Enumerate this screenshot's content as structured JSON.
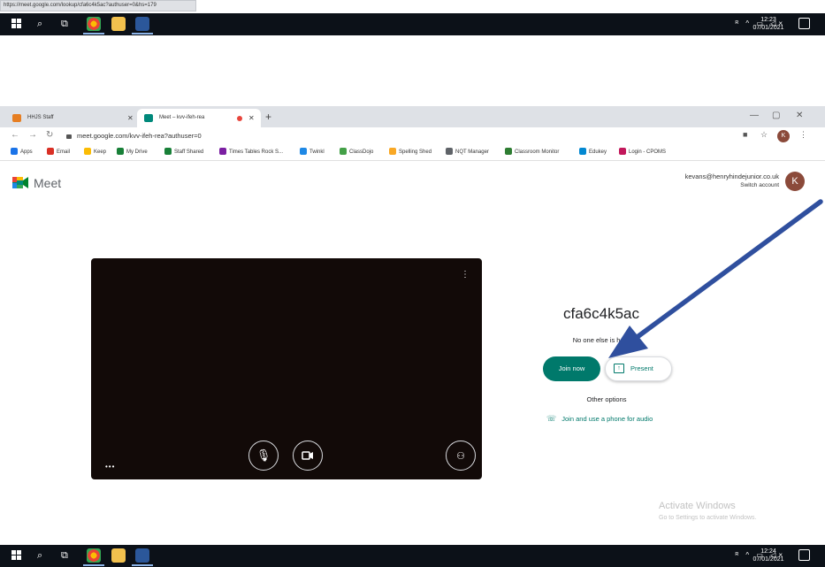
{
  "status_url": "https://meet.google.com/lookup/cfa6c4k5ac?authuser=0&hs=179",
  "taskbar_top": {
    "time": "12:23",
    "date": "07/01/2021"
  },
  "taskbar_bottom": {
    "time": "12:24",
    "date": "07/01/2021"
  },
  "browser": {
    "tabs": [
      {
        "label": "HHJS Staff"
      },
      {
        "label": "Meet – kvv-ifeh-rea"
      }
    ],
    "address": "meet.google.com/kvv-ifeh-rea?authuser=0",
    "profile_initial": "K",
    "bookmarks": [
      {
        "label": "Apps",
        "color": "#1a73e8"
      },
      {
        "label": "Email",
        "color": "#d93025"
      },
      {
        "label": "Keep",
        "color": "#fbbc04"
      },
      {
        "label": "My Drive",
        "color": "#188038"
      },
      {
        "label": "Staff Shared",
        "color": "#188038"
      },
      {
        "label": "Times Tables Rock S...",
        "color": "#7b1fa2"
      },
      {
        "label": "Twinkl",
        "color": "#1e88e5"
      },
      {
        "label": "ClassDojo",
        "color": "#43a047"
      },
      {
        "label": "Spelling Shed",
        "color": "#f9a825"
      },
      {
        "label": "NQT Manager",
        "color": "#5f6368"
      },
      {
        "label": "Classroom Monitor",
        "color": "#2e7d32"
      },
      {
        "label": "Edukey",
        "color": "#0288d1"
      },
      {
        "label": "Login - CPOMS",
        "color": "#c2185b"
      }
    ]
  },
  "meet": {
    "logo_text": "Meet",
    "account_email": "kevans@henryhindejunior.co.uk",
    "switch_account": "Switch account",
    "avatar_initial": "K",
    "meeting_code": "cfa6c4k5ac",
    "status": "No one else is here",
    "join_label": "Join now",
    "present_label": "Present",
    "other_options": "Other options",
    "phone_audio": "Join and use a phone for audio"
  },
  "activate_windows": {
    "title": "Activate Windows",
    "subtitle": "Go to Settings to activate Windows."
  },
  "colors": {
    "accent": "#00796b",
    "annotation_arrow": "#2f4f9e"
  }
}
